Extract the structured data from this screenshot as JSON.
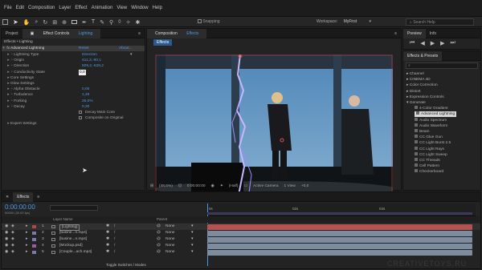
{
  "menu": [
    "File",
    "Edit",
    "Composition",
    "Layer",
    "Effect",
    "Animation",
    "View",
    "Window",
    "Help"
  ],
  "toolbar": {
    "snapping": "Snapping",
    "workspace_label": "Workspace:",
    "workspace_value": "MyFirst",
    "search_placeholder": "Search Help"
  },
  "project_panel": {
    "tab_project": "Project",
    "tab_effect_controls": "Effect Controls",
    "layer_name": "Lighting",
    "breadcrumb": "Effects • Lighting"
  },
  "effect": {
    "name": "Advanced Lightning",
    "reset": "Reset",
    "about": "About...",
    "props": [
      {
        "label": "Lightning Type",
        "value": "Direction",
        "dropdown": true
      },
      {
        "label": "Origin",
        "value": "411,3,-90,1"
      },
      {
        "label": "Direction",
        "value": "509,2,-628,2"
      },
      {
        "label": "Conductivity State",
        "value": "0,0",
        "editing": true
      },
      {
        "label": "Core Settings",
        "value": "",
        "group": true
      },
      {
        "label": "Glow Settings",
        "value": "",
        "group": true
      },
      {
        "label": "Alpha Obstacle",
        "value": "0,00"
      },
      {
        "label": "Turbulence",
        "value": "1,49"
      },
      {
        "label": "Forking",
        "value": "25,0%"
      },
      {
        "label": "Decay",
        "value": "0,30"
      },
      {
        "label": "",
        "value": "Decay Main Core",
        "checkbox": true
      },
      {
        "label": "",
        "value": "Composite on Original",
        "checkbox": true
      },
      {
        "label": "Expert Settings",
        "value": "",
        "group": true
      }
    ]
  },
  "composition": {
    "tab": "Composition",
    "comp_name": "Effects",
    "sub_tab": "Effects",
    "zoom": "(48,6%)",
    "timecode": "0:00:00:00",
    "resolution": "(Half)",
    "camera": "Active Camera",
    "views": "1 View",
    "offset": "+0,0"
  },
  "right_panels": {
    "preview_tab": "Preview",
    "info_tab": "Info",
    "effects_presets": "Effects & Presets",
    "search_value": "",
    "categories": [
      {
        "label": "Channel",
        "open": false
      },
      {
        "label": "CINEMA 4D",
        "open": false
      },
      {
        "label": "Color Correction",
        "open": false
      },
      {
        "label": "Distort",
        "open": false
      },
      {
        "label": "Expression Controls",
        "open": false
      },
      {
        "label": "Generate",
        "open": true
      }
    ],
    "generate_items": [
      "4-Color Gradient",
      "Advanced Lightning",
      "Audio Spectrum",
      "Audio Waveform",
      "Beam",
      "CC Glue Gun",
      "CC Light Burst 2.5",
      "CC Light Rays",
      "CC Light Sweep",
      "CC Threads",
      "Cell Pattern",
      "Checkerboard"
    ],
    "selected_item": "Advanced Lightning"
  },
  "timeline": {
    "tab": "Effects",
    "timecode": "0:00:00:00",
    "frame_info": "00000 (30.00 fps)",
    "col_layer_name": "Layer Name",
    "col_parent": "Parent",
    "ruler": [
      "0s",
      "02s",
      "04s"
    ],
    "layers": [
      {
        "num": "1",
        "name": "[Lighting]",
        "parent": "None",
        "color": "#b04a4a",
        "selected": true
      },
      {
        "num": "2",
        "name": "[busine...n.mp4]",
        "parent": "None",
        "color": "#7a7ab0"
      },
      {
        "num": "3",
        "name": "[busine...n.mp4]",
        "parent": "None",
        "color": "#7a7ab0"
      },
      {
        "num": "4",
        "name": "[Mockup.psd]",
        "parent": "None",
        "color": "#a05aa0"
      },
      {
        "num": "5",
        "name": "[Couple...ach.mp4]",
        "parent": "None",
        "color": "#7a7ab0"
      }
    ],
    "toggle_label": "Toggle Switches / Modes"
  },
  "watermark": "CREATIVETOYS.RU"
}
